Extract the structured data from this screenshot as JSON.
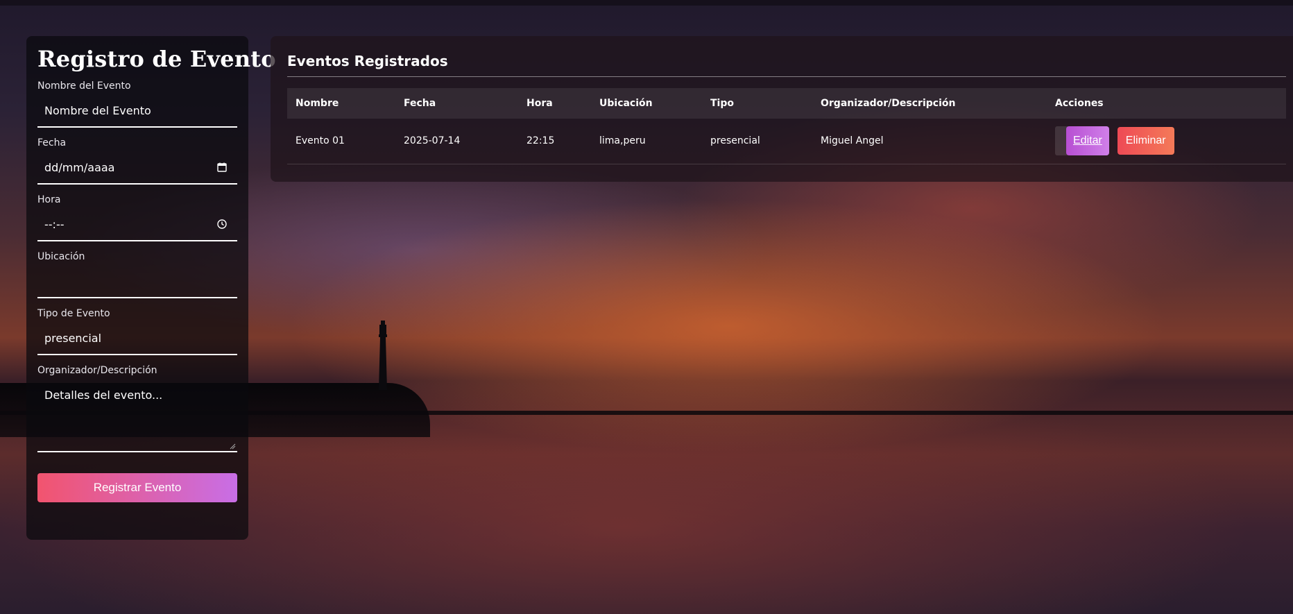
{
  "form": {
    "title": "Registro de Evento",
    "fields": {
      "nombre": {
        "label": "Nombre del Evento",
        "placeholder": "Nombre del Evento"
      },
      "fecha": {
        "label": "Fecha",
        "placeholder": "dd/mm/aaaa"
      },
      "hora": {
        "label": "Hora",
        "placeholder": "--:--"
      },
      "ubicacion": {
        "label": "Ubicación",
        "placeholder": ""
      },
      "tipo": {
        "label": "Tipo de Evento",
        "value": "presencial"
      },
      "descripcion": {
        "label": "Organizador/Descripción",
        "placeholder": "Detalles del evento..."
      }
    },
    "submit_label": "Registrar Evento",
    "icons": {
      "fecha": "calendar-icon",
      "hora": "clock-icon"
    }
  },
  "events": {
    "title": "Eventos Registrados",
    "columns": [
      "Nombre",
      "Fecha",
      "Hora",
      "Ubicación",
      "Tipo",
      "Organizador/Descripción",
      "Acciones"
    ],
    "rows": [
      {
        "nombre": "Evento 01",
        "fecha": "2025-07-14",
        "hora": "22:15",
        "ubicacion": "lima,peru",
        "tipo": "presencial",
        "descripcion": "Miguel Angel",
        "edit_label": "Editar",
        "delete_label": "Eliminar"
      }
    ]
  },
  "colors": {
    "submit_gradient": [
      "#f2546e",
      "#c86ee6"
    ],
    "edit_gradient": [
      "#b74fd2",
      "#d07fe9"
    ],
    "delete_gradient": [
      "#ee4a55",
      "#f47a58"
    ]
  }
}
